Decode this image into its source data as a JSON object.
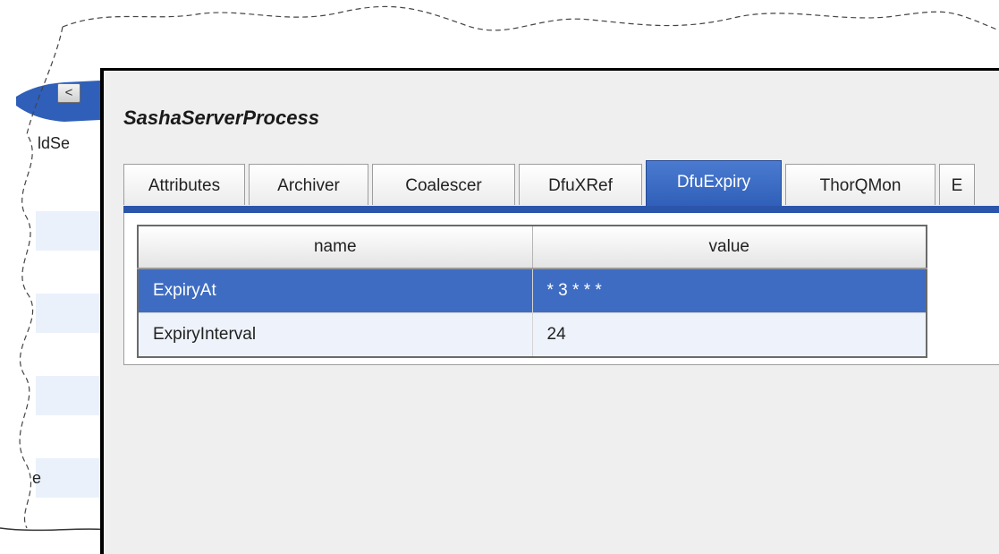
{
  "left_pane": {
    "collapse_glyph": "<",
    "label_fragment": "ldSe",
    "bottom_fragment": "e"
  },
  "panel": {
    "title": "SashaServerProcess"
  },
  "tabs": [
    {
      "label": "Attributes",
      "active": false
    },
    {
      "label": "Archiver",
      "active": false
    },
    {
      "label": "Coalescer",
      "active": false
    },
    {
      "label": "DfuXRef",
      "active": false
    },
    {
      "label": "DfuExpiry",
      "active": true
    },
    {
      "label": "ThorQMon",
      "active": false
    },
    {
      "label": "E",
      "active": false
    }
  ],
  "grid": {
    "columns": [
      "name",
      "value"
    ],
    "rows": [
      {
        "name": "ExpiryAt",
        "value": "* 3 * * *",
        "selected": true
      },
      {
        "name": "ExpiryInterval",
        "value": "24",
        "selected": false
      }
    ]
  },
  "colors": {
    "accent": "#2b55ab",
    "selected_row": "#3e6cc2",
    "panel_bg": "#efefef"
  }
}
